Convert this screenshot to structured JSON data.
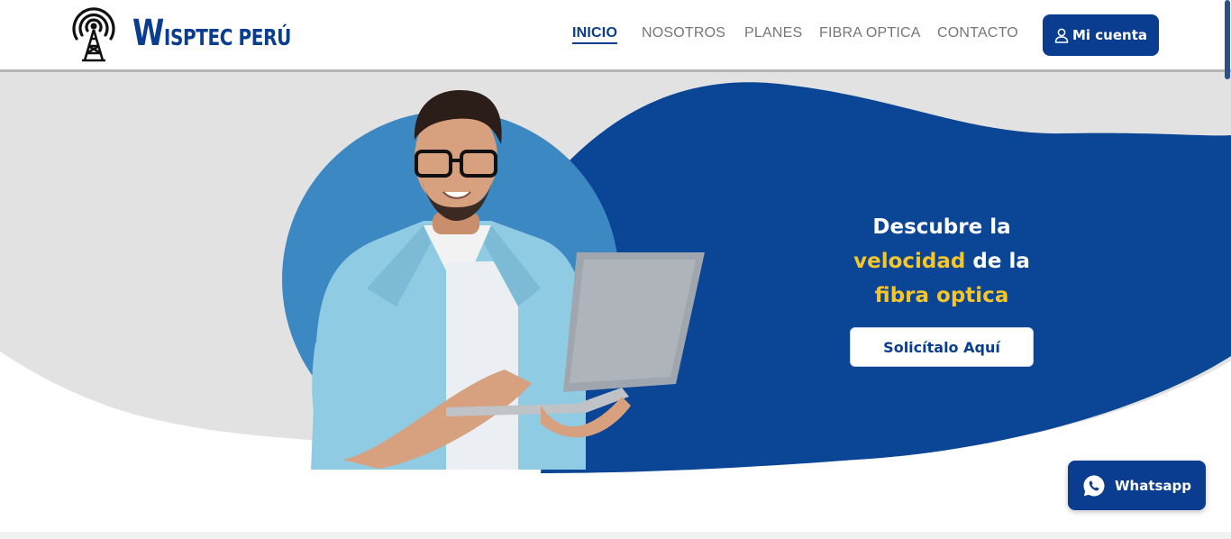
{
  "brand": {
    "name_initial": "W",
    "name_rest": "ISPTEC PERÚ",
    "logo_icon": "antenna-tower-icon"
  },
  "nav": {
    "items": [
      {
        "label": "INICIO",
        "active": true
      },
      {
        "label": "NOSOTROS",
        "active": false
      },
      {
        "label": "PLANES",
        "active": false
      },
      {
        "label": "FIBRA OPTICA",
        "active": false
      },
      {
        "label": "CONTACTO",
        "active": false
      }
    ],
    "account_label": "Mi cuenta",
    "account_icon": "user-icon"
  },
  "hero": {
    "line1": "Descubre la",
    "line2_highlight": "velocidad",
    "line2_rest": " de la",
    "line3_highlight": "fibra optica",
    "cta_label": "Solicítalo Aquí"
  },
  "whatsapp": {
    "label": "Whatsapp",
    "icon": "whatsapp-icon"
  },
  "colors": {
    "brand_blue": "#0a3d8f",
    "accent_yellow": "#f5c52a",
    "circle_blue": "#3b88c3",
    "hero_gray": "#e2e2e2"
  }
}
